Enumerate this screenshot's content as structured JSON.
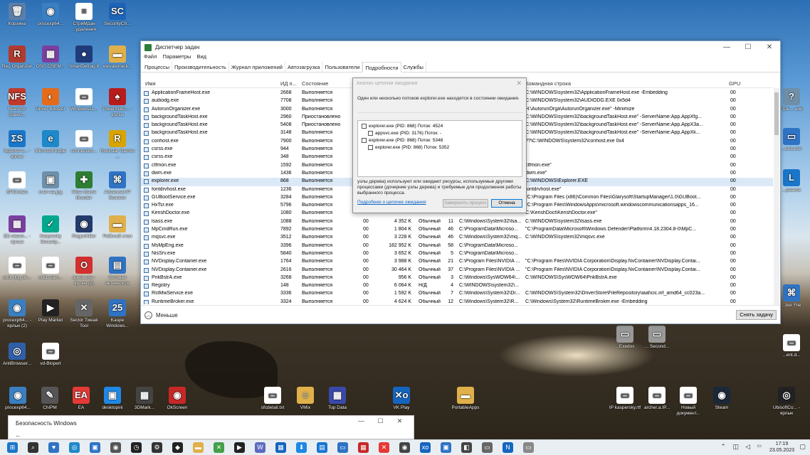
{
  "desktop": {
    "icons": [
      {
        "label": "Корзина",
        "glyph": "🗑",
        "color": "#5a7fa8"
      },
      {
        "label": "procexp64...",
        "glyph": "◉",
        "color": "#3a7fc1"
      },
      {
        "label": "СтриМдан ...удаления",
        "glyph": "≡",
        "color": "#ffffff"
      },
      {
        "label": "SecurityCh...",
        "glyph": "SC",
        "color": "#1d63b8"
      },
      {
        "label": "Reg Organizer",
        "glyph": "R",
        "color": "#b03a2e"
      },
      {
        "label": "OSG DSEM...",
        "glyph": "▦",
        "color": "#7b3fa0"
      },
      {
        "label": "SmartDefrag 8",
        "glyph": "●",
        "color": "#1f3b7a"
      },
      {
        "label": "elevatetrack...",
        "glyph": "▬",
        "color": "#e0b04a"
      },
      {
        "label": "Need for Speed...",
        "glyph": "NFS",
        "color": "#c0392b"
      },
      {
        "label": "Driver Booster",
        "glyph": "◐",
        "color": "#e36b1a"
      },
      {
        "label": "Windows11...",
        "glyph": "▭",
        "color": "#ffffff"
      },
      {
        "label": "PokerStars... - ярлык",
        "glyph": "♠",
        "color": "#b71c1c"
      },
      {
        "label": "logitune-s... - ярлык",
        "glyph": "ΣS",
        "color": "#1a76c9"
      },
      {
        "label": "Microsoft Edge",
        "glyph": "e",
        "color": "#1e88c9"
      },
      {
        "label": "connection...",
        "glyph": "▭",
        "color": "#ffffff"
      },
      {
        "label": "Rockstar Games ...",
        "glyph": "R",
        "color": "#d9a400"
      },
      {
        "label": "SPOnotes",
        "glyph": "▭",
        "color": "#ffffff"
      },
      {
        "label": "счет-на.jpg",
        "glyph": "▣",
        "color": "#6f8fa8"
      },
      {
        "label": "Wise Game Booster",
        "glyph": "✚",
        "color": "#2e7d32"
      },
      {
        "label": "Advanced IP Scanner",
        "glyph": "⌘",
        "color": "#2f73c4"
      },
      {
        "label": "EE-steam... - ярлык",
        "glyph": "▦",
        "color": "#7b3fa0"
      },
      {
        "label": "Kaspersky Security...",
        "glyph": "✓",
        "color": "#00a88e"
      },
      {
        "label": "RogueKiller",
        "glyph": "◉",
        "color": "#243a6b"
      },
      {
        "label": "Рабочий стол",
        "glyph": "▬",
        "color": "#e0b04a"
      },
      {
        "label": "orbit (log de...",
        "glyph": "▭",
        "color": "#ffffff"
      },
      {
        "label": "orbit-siam...",
        "glyph": "▭",
        "color": "#ffffff"
      },
      {
        "label": "opera.exe - ярлык (2)",
        "glyph": "O",
        "color": "#d32f2f"
      },
      {
        "label": "Сетевая активность",
        "glyph": "▤",
        "color": "#2f73c4"
      },
      {
        "label": "procexp64... - ярлык (2)",
        "glyph": "◉",
        "color": "#3a7fc1"
      },
      {
        "label": "Play Market",
        "glyph": "▶",
        "color": "#222222"
      },
      {
        "label": "Sector Tweak Tool",
        "glyph": "✕",
        "color": "#666666"
      },
      {
        "label": "Kaspe Windows...",
        "glyph": "25",
        "color": "#2f73c4"
      },
      {
        "label": "AntiBrowser...",
        "glyph": "◎",
        "color": "#2f5fa8"
      },
      {
        "label": "vd-Blopert",
        "glyph": "▭",
        "color": "#ffffff"
      }
    ],
    "right_icons": [
      {
        "label": "ПОн ...ний",
        "glyph": "?",
        "color": "#6f8fa8"
      },
      {
        "label": "...une.exe",
        "glyph": "▭",
        "color": "#2f73c4"
      },
      {
        "label": "...ранков",
        "glyph": "L",
        "color": "#1a76c9"
      },
      {
        "label": "...ber File",
        "glyph": "⌘",
        "color": "#2f73c4"
      },
      {
        "label": "...ent.d...",
        "glyph": "▭",
        "color": "#ffffff"
      }
    ],
    "bottom_icons": [
      {
        "label": "procexp64...",
        "glyph": "◉",
        "color": "#3a7fc1"
      },
      {
        "label": "ChiPM",
        "glyph": "✎",
        "color": "#555555"
      },
      {
        "label": "EA",
        "glyph": "EA",
        "color": "#e53935"
      },
      {
        "label": "desktopini",
        "glyph": "▣",
        "color": "#1e88e5"
      },
      {
        "label": "3DMark...",
        "glyph": "▦",
        "color": "#444444"
      },
      {
        "label": "OkScreen",
        "glyph": "◉",
        "color": "#c62828"
      },
      {
        "label": "sfcdetail.txt",
        "glyph": "▭",
        "color": "#ffffff"
      },
      {
        "label": "VMix",
        "glyph": "☺",
        "color": "#e0b04a"
      },
      {
        "label": "Top Data",
        "glyph": "▦",
        "color": "#3949ab"
      },
      {
        "label": "VK Play",
        "glyph": "✕o",
        "color": "#1565c0"
      },
      {
        "label": "PortableApps",
        "glyph": "▬",
        "color": "#e0b04a"
      },
      {
        "label": "IP kaspersky.rtf",
        "glyph": "▭",
        "color": "#ffffff"
      },
      {
        "label": "archer.a.IP...",
        "glyph": "▭",
        "color": "#ffffff"
      },
      {
        "label": "Новый документ...",
        "glyph": "▭",
        "color": "#ffffff"
      },
      {
        "label": "Steam",
        "glyph": "◉",
        "color": "#1b2838"
      },
      {
        "label": "UbisoftCo... - ярлык",
        "glyph": "◎",
        "color": "#222222"
      },
      {
        "label": "...Exedos",
        "glyph": "▭",
        "color": "#999999"
      },
      {
        "label": "... Second...",
        "glyph": "▭",
        "color": "#999999"
      }
    ]
  },
  "task_manager": {
    "title": "Диспетчер задач",
    "window_controls": [
      "—",
      "☐",
      "✕"
    ],
    "menu": [
      "Файл",
      "Параметры",
      "Вид"
    ],
    "tabs": [
      "Процессы",
      "Производительность",
      "Журнал приложений",
      "Автозагрузка",
      "Пользователи",
      "Подробности",
      "Службы"
    ],
    "active_tab": "Подробности",
    "columns": {
      "name": "Имя",
      "pid": "ИД п...",
      "status": "Состояние",
      "command": "Командная строка",
      "gpu": "GPU"
    },
    "rows": [
      {
        "name": "ApplicationFrameHost.exe",
        "pid": "2668",
        "status": "Выполняется",
        "user": "",
        "mem": "",
        "prio": "",
        "n": "",
        "path": "",
        "cmd": "C:\\WINDOWS\\system32\\ApplicationFrameHost.exe -Embedding",
        "gpu": "00"
      },
      {
        "name": "audiodg.exe",
        "pid": "7708",
        "status": "Выполняется",
        "user": "",
        "mem": "",
        "prio": "",
        "n": "",
        "path": "",
        "cmd": "C:\\WINDOWS\\system32\\AUDIODG.EXE 0x5d4",
        "gpu": "00"
      },
      {
        "name": "AutorunOrganizer.exe",
        "pid": "3000",
        "status": "Выполняется",
        "user": "",
        "mem": "",
        "prio": "",
        "n": "",
        "path": "",
        "cmd": "H:\\AutorunOrga\\AutorunOrganizer.exe\" -Minimize",
        "gpu": "00"
      },
      {
        "name": "backgroundTaskHost.exe",
        "pid": "2960",
        "status": "Приостановлено",
        "user": "",
        "mem": "",
        "prio": "",
        "n": "",
        "path": "",
        "cmd": "C:\\WINDOWS\\system32\\backgroundTaskHost.exe\" -ServerName:App.AppXfg...",
        "gpu": "00"
      },
      {
        "name": "backgroundTaskHost.exe",
        "pid": "5408",
        "status": "Приостановлено",
        "user": "",
        "mem": "",
        "prio": "",
        "n": "",
        "path": "",
        "cmd": "C:\\WINDOWS\\system32\\backgroundTaskHost.exe\" -ServerName:App.AppX3a...",
        "gpu": "00"
      },
      {
        "name": "backgroundTaskHost.exe",
        "pid": "3148",
        "status": "Выполняется",
        "user": "",
        "mem": "",
        "prio": "",
        "n": "",
        "path": "",
        "cmd": "C:\\WINDOWS\\system32\\backgroundTaskHost.exe\" -ServerName:App.AppXk...",
        "gpu": "00"
      },
      {
        "name": "conhost.exe",
        "pid": "7900",
        "status": "Выполняется",
        "user": "",
        "mem": "",
        "prio": "",
        "n": "",
        "path": "",
        "cmd": "??\\C:\\WINDOWS\\system32\\conhost.exe 0x4",
        "gpu": "00"
      },
      {
        "name": "csrss.exe",
        "pid": "944",
        "status": "Выполняется",
        "user": "",
        "mem": "",
        "prio": "",
        "n": "",
        "path": "",
        "cmd": "",
        "gpu": "00"
      },
      {
        "name": "csrss.exe",
        "pid": "348",
        "status": "Выполняется",
        "user": "",
        "mem": "",
        "prio": "",
        "n": "",
        "path": "",
        "cmd": "",
        "gpu": "00"
      },
      {
        "name": "ctfmon.exe",
        "pid": "1592",
        "status": "Выполняется",
        "user": "",
        "mem": "",
        "prio": "",
        "n": "",
        "path": "",
        "cmd": "ctfmon.exe\"",
        "gpu": "00"
      },
      {
        "name": "dwm.exe",
        "pid": "1436",
        "status": "Выполняется",
        "user": "",
        "mem": "",
        "prio": "",
        "n": "",
        "path": "",
        "cmd": "dwm.exe\"",
        "gpu": "00"
      },
      {
        "name": "explorer.exe",
        "pid": "868",
        "status": "Выполняется",
        "user": "",
        "mem": "",
        "prio": "",
        "n": "",
        "path": "",
        "cmd": "C:\\WINDOWS\\Explorer.EXE",
        "gpu": "00",
        "selected": true
      },
      {
        "name": "fontdrvhost.exe",
        "pid": "1236",
        "status": "Выполняется",
        "user": "",
        "mem": "",
        "prio": "",
        "n": "",
        "path": "",
        "cmd": "fontdrvhost.exe\"",
        "gpu": "00"
      },
      {
        "name": "GUBootService.exe",
        "pid": "3284",
        "status": "Выполняется",
        "user": "",
        "mem": "",
        "prio": "",
        "n": "",
        "path": "",
        "cmd": "\"C:\\Program Files (x86)\\Common Files\\Glarysoft\\StartupManager\\1.0\\GUBoot...",
        "gpu": "00"
      },
      {
        "name": "HxTsr.exe",
        "pid": "5796",
        "status": "Выполняется",
        "user": "",
        "mem": "",
        "prio": "",
        "n": "",
        "path": "",
        "cmd": "\"C:\\Program Files\\WindowsApps\\microsoft.windowscommunicationsapps_16...",
        "gpu": "00"
      },
      {
        "name": "KerishDoctor.exe",
        "pid": "1080",
        "status": "Выполняется",
        "user": "",
        "mem": "",
        "prio": "",
        "n": "",
        "path": "",
        "cmd": "C:\\KerishDoct\\KerishDoctor.exe\"",
        "gpu": "00"
      },
      {
        "name": "lsass.exe",
        "pid": "1088",
        "status": "Выполняется",
        "user": "00",
        "mem": "4 352 K",
        "prio": "Обычный",
        "n": "11",
        "path": "C:\\Windows\\System32\\lsa...",
        "cmd": "C:\\WINDOWS\\system32\\lsass.exe",
        "gpu": "00"
      },
      {
        "name": "MpCmdRun.exe",
        "pid": "7892",
        "status": "Выполняется",
        "user": "00",
        "mem": "1 804 K",
        "prio": "Обычный",
        "n": "46",
        "path": "C:\\ProgramData\\Microso...",
        "cmd": "\"C:\\ProgramData\\Microsoft\\Windows Defender\\Platform\\4.18.2304.8-0\\MpC...",
        "gpu": "00"
      },
      {
        "name": "mqsvc.exe",
        "pid": "3512",
        "status": "Выполняется",
        "user": "00",
        "mem": "3 228 K",
        "prio": "Обычный",
        "n": "46",
        "path": "C:\\Windows\\System32\\mq...",
        "cmd": "C:\\WINDOWS\\system32\\mqsvc.exe",
        "gpu": "00"
      },
      {
        "name": "MsMpEng.exe",
        "pid": "3396",
        "status": "Выполняется",
        "user": "00",
        "mem": "182 952 K",
        "prio": "Обычный",
        "n": "58",
        "path": "C:\\ProgramData\\Microso...",
        "cmd": "",
        "gpu": "00"
      },
      {
        "name": "NisSrv.exe",
        "pid": "5840",
        "status": "Выполняется",
        "user": "00",
        "mem": "3 652 K",
        "prio": "Обычный",
        "n": "5",
        "path": "C:\\ProgramData\\Microso...",
        "cmd": "",
        "gpu": "00"
      },
      {
        "name": "NVDisplay.Container.exe",
        "pid": "1764",
        "status": "Выполняется",
        "user": "00",
        "mem": "3 988 K",
        "prio": "Обычный",
        "n": "21",
        "path": "C:\\Program Files\\NVIDIA ...",
        "cmd": "\"C:\\Program Files\\NVIDIA Corporation\\Display.NvContainer\\NVDisplay.Contai...",
        "gpu": "00"
      },
      {
        "name": "NVDisplay.Container.exe",
        "pid": "2616",
        "status": "Выполняется",
        "user": "00",
        "mem": "30 464 K",
        "prio": "Обычный",
        "n": "37",
        "path": "C:\\Program Files\\NVIDIA ...",
        "cmd": "\"C:\\Program Files\\NVIDIA Corporation\\Display.NvContainer\\NVDisplay.Contai...",
        "gpu": "00"
      },
      {
        "name": "PnkBstrA.exe",
        "pid": "3268",
        "status": "Выполняется",
        "user": "00",
        "mem": "956 K",
        "prio": "Обычный",
        "n": "3",
        "path": "C:\\Windows\\SysWOW64\\...",
        "cmd": "C:\\WINDOWS\\SysWOW64\\PnkBstrA.exe",
        "gpu": "00"
      },
      {
        "name": "Registry",
        "pid": "148",
        "status": "Выполняется",
        "user": "00",
        "mem": "6 064 K",
        "prio": "Н/Д",
        "n": "4",
        "path": "C:\\WINDOWS\\system32\\...",
        "cmd": "",
        "gpu": "00"
      },
      {
        "name": "RstMwService.exe",
        "pid": "3336",
        "status": "Выполняется",
        "user": "00",
        "mem": "1 592 K",
        "prio": "Обычный",
        "n": "7",
        "path": "C:\\Windows\\System32\\Dr...",
        "cmd": "C:\\WINDOWS\\System32\\DriverStore\\FileRepository\\iaahcic.inf_amd64_cc023a...",
        "gpu": "00"
      },
      {
        "name": "RuntimeBroker.exe",
        "pid": "3324",
        "status": "Выполняется",
        "user": "00",
        "mem": "4 624 K",
        "prio": "Обычный",
        "n": "12",
        "path": "C:\\Windows\\System32\\R...",
        "cmd": "C:\\Windows\\System32\\RuntimeBroker.exe -Embedding",
        "gpu": "00"
      }
    ],
    "less_label": "Меньше",
    "end_task_label": "Снять задачу"
  },
  "wait_chain": {
    "title": "Анализ цепочки ожидания",
    "info": "Один или несколько потоков explorer.exe находятся в состоянии ожидания.",
    "tree": [
      "explorer.exe (PID: 868) Поток: 4524",
      "appsvc.exe (PID: 3176) Поток: -",
      "explorer.exe (PID: 868) Поток: 5348",
      "explorer.exe (PID: 868) Поток: 5352"
    ],
    "desc": "узлы дерева) используют или ожидают ресурсы, используемые другими процессами (дочерние узлы дерева) и требуемые для продолжения работы выбранного процесса.",
    "link": "Подробнее о цепочке ожидания",
    "end_process_label": "Завершить процесс",
    "cancel_label": "Отмена"
  },
  "security_window": {
    "title": "Безопасность Windows",
    "back": "←",
    "controls": [
      "—",
      "☐",
      "✕"
    ]
  },
  "taskbar": {
    "time": "17:19",
    "date": "23.05.2023",
    "icons": [
      {
        "glyph": "⊞",
        "color": "#1a76c9"
      },
      {
        "glyph": "⌕",
        "color": "#333333"
      },
      {
        "glyph": "♥",
        "color": "#2f73c4"
      },
      {
        "glyph": "◎",
        "color": "#1e88c9"
      },
      {
        "glyph": "▣",
        "color": "#2f73c4"
      },
      {
        "glyph": "◉",
        "color": "#555555"
      },
      {
        "glyph": "◷",
        "color": "#222222"
      },
      {
        "glyph": "⚙",
        "color": "#333333"
      },
      {
        "glyph": "◆",
        "color": "#222222"
      },
      {
        "glyph": "▬",
        "color": "#e0b04a"
      },
      {
        "glyph": "✕",
        "color": "#43a047"
      },
      {
        "glyph": "▶",
        "color": "#222222"
      },
      {
        "glyph": "W",
        "color": "#5c6bc0"
      },
      {
        "glyph": "▦",
        "color": "#1565c0"
      },
      {
        "glyph": "⬇",
        "color": "#1e88e5"
      },
      {
        "glyph": "▤",
        "color": "#1976d2"
      },
      {
        "glyph": "▭",
        "color": "#2f73c4"
      },
      {
        "glyph": "▦",
        "color": "#c62828"
      },
      {
        "glyph": "✕",
        "color": "#e53935"
      },
      {
        "glyph": "◉",
        "color": "#444444"
      },
      {
        "glyph": "xo",
        "color": "#1565c0"
      },
      {
        "glyph": "▣",
        "color": "#2f73c4"
      },
      {
        "glyph": "◧",
        "color": "#444444"
      },
      {
        "glyph": "▭",
        "color": "#666666"
      },
      {
        "glyph": "N",
        "color": "#1565c0"
      },
      {
        "glyph": "▭",
        "color": "#888888"
      }
    ]
  }
}
